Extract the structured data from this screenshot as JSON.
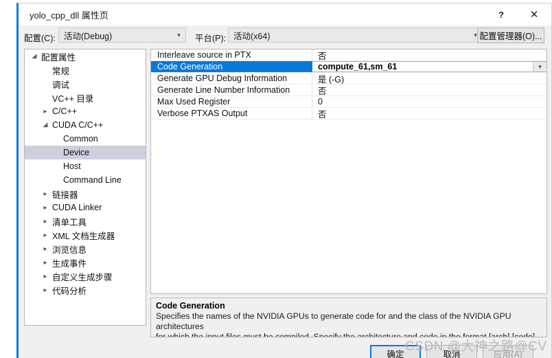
{
  "window": {
    "title": "yolo_cpp_dll 属性页",
    "help_icon": "?",
    "close_icon": "✕"
  },
  "config_bar": {
    "configuration_label": "配置(C):",
    "configuration_value": "活动(Debug)",
    "platform_label": "平台(P):",
    "platform_value": "活动(x64)",
    "config_manager_button": "配置管理器(O)..."
  },
  "tree": {
    "items": [
      {
        "label": "配置属性",
        "indent": 0,
        "twisty": "expanded",
        "selected": false
      },
      {
        "label": "常规",
        "indent": 1,
        "twisty": "none",
        "selected": false
      },
      {
        "label": "调试",
        "indent": 1,
        "twisty": "none",
        "selected": false
      },
      {
        "label": "VC++ 目录",
        "indent": 1,
        "twisty": "none",
        "selected": false
      },
      {
        "label": "C/C++",
        "indent": 1,
        "twisty": "collapsed",
        "selected": false
      },
      {
        "label": "CUDA C/C++",
        "indent": 1,
        "twisty": "expanded",
        "selected": false
      },
      {
        "label": "Common",
        "indent": 2,
        "twisty": "none",
        "selected": false
      },
      {
        "label": "Device",
        "indent": 2,
        "twisty": "none",
        "selected": true
      },
      {
        "label": "Host",
        "indent": 2,
        "twisty": "none",
        "selected": false
      },
      {
        "label": "Command Line",
        "indent": 2,
        "twisty": "none",
        "selected": false
      },
      {
        "label": "链接器",
        "indent": 1,
        "twisty": "collapsed",
        "selected": false
      },
      {
        "label": "CUDA Linker",
        "indent": 1,
        "twisty": "collapsed",
        "selected": false
      },
      {
        "label": "清单工具",
        "indent": 1,
        "twisty": "collapsed",
        "selected": false
      },
      {
        "label": "XML 文档生成器",
        "indent": 1,
        "twisty": "collapsed",
        "selected": false
      },
      {
        "label": "浏览信息",
        "indent": 1,
        "twisty": "collapsed",
        "selected": false
      },
      {
        "label": "生成事件",
        "indent": 1,
        "twisty": "collapsed",
        "selected": false
      },
      {
        "label": "自定义生成步骤",
        "indent": 1,
        "twisty": "collapsed",
        "selected": false
      },
      {
        "label": "代码分析",
        "indent": 1,
        "twisty": "collapsed",
        "selected": false
      }
    ]
  },
  "grid": {
    "rows": [
      {
        "name": "Interleave source in PTX",
        "value": "否",
        "selected": false,
        "editing": false
      },
      {
        "name": "Code Generation",
        "value": "compute_61,sm_61",
        "selected": true,
        "editing": true
      },
      {
        "name": "Generate GPU Debug Information",
        "value": "是 (-G)",
        "selected": false,
        "editing": false
      },
      {
        "name": "Generate Line Number Information",
        "value": "否",
        "selected": false,
        "editing": false
      },
      {
        "name": "Max Used Register",
        "value": "0",
        "selected": false,
        "editing": false
      },
      {
        "name": "Verbose PTXAS Output",
        "value": "否",
        "selected": false,
        "editing": false
      }
    ],
    "dropdown_arrow": "⌄"
  },
  "description": {
    "title": "Code Generation",
    "body": "Specifies the names of the NVIDIA GPUs to generate code for and the class of the NVIDIA GPU architectures\nfor which the input files must be compiled.  Specify the architecture and code in the format [arch],[code], mul..."
  },
  "footer": {
    "ok_label": "确定",
    "cancel_label": "取消",
    "apply_label": "应用(A)"
  },
  "watermark": {
    "text": "CSDN @大神之路@CV"
  },
  "colors": {
    "accent": "#0a78d7",
    "tree_selection": "#cdcede",
    "dialog_bg": "#f0f0f0"
  }
}
